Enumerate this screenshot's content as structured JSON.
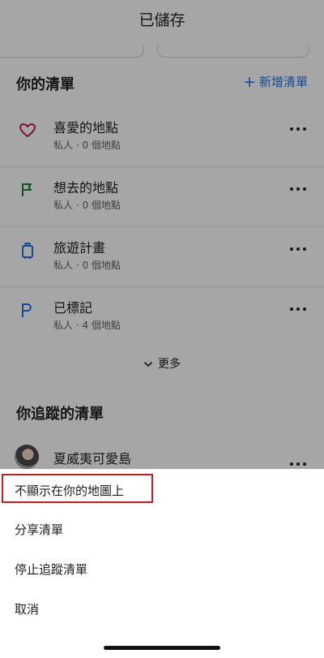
{
  "header": {
    "title": "已儲存"
  },
  "your_lists": {
    "heading": "你的清單",
    "new_list_label": "新增清單",
    "items": [
      {
        "title": "喜愛的地點",
        "subtitle": "私人 · 0 個地點",
        "icon": "heart-icon",
        "icon_color": "#c2185b"
      },
      {
        "title": "想去的地點",
        "subtitle": "私人 · 0 個地點",
        "icon": "flag-icon",
        "icon_color": "#188038"
      },
      {
        "title": "旅遊計畫",
        "subtitle": "私人 · 0 個地點",
        "icon": "suitcase-icon",
        "icon_color": "#1a73e8"
      },
      {
        "title": "已標記",
        "subtitle": "私人 · 4 個地點",
        "icon": "pennant-icon",
        "icon_color": "#1a73e8"
      }
    ],
    "more_label": "更多"
  },
  "followed_lists": {
    "heading": "你追蹤的清單",
    "items": [
      {
        "title": "夏威夷可愛島"
      }
    ]
  },
  "bottom_sheet": {
    "options": [
      {
        "label": "不顯示在你的地圖上",
        "highlighted": true
      },
      {
        "label": "分享清單"
      },
      {
        "label": "停止追蹤清單"
      },
      {
        "label": "取消"
      }
    ]
  },
  "colors": {
    "accent": "#1a73e8",
    "highlight_border": "#c81e1e",
    "scrim": "rgba(0,0,0,0.35)"
  }
}
